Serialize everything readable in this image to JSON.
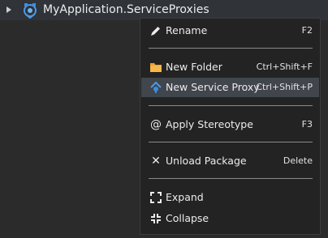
{
  "tree": {
    "label": "MyApplication.ServiceProxies",
    "icon": "service-proxies-package-icon"
  },
  "menu": {
    "items": [
      {
        "label": "Rename",
        "shortcut": "F2",
        "icon": "pencil-icon"
      },
      {
        "label": "New Folder",
        "shortcut": "Ctrl+Shift+F",
        "icon": "folder-icon"
      },
      {
        "label": "New Service Proxy",
        "shortcut": "Ctrl+Shift+P",
        "icon": "service-proxy-icon",
        "highlighted": true
      },
      {
        "label": "Apply Stereotype",
        "shortcut": "F3",
        "icon": "at-sign-icon"
      },
      {
        "label": "Unload Package",
        "shortcut": "Delete",
        "icon": "x-icon"
      },
      {
        "label": "Expand",
        "shortcut": "",
        "icon": "expand-icon"
      },
      {
        "label": "Collapse",
        "shortcut": "",
        "icon": "collapse-icon"
      }
    ]
  },
  "colors": {
    "background": "#2b2b2b",
    "menu_background": "#232323",
    "highlight": "#41454c",
    "accent_blue": "#3a8ee6",
    "folder_orange": "#f0a030"
  }
}
